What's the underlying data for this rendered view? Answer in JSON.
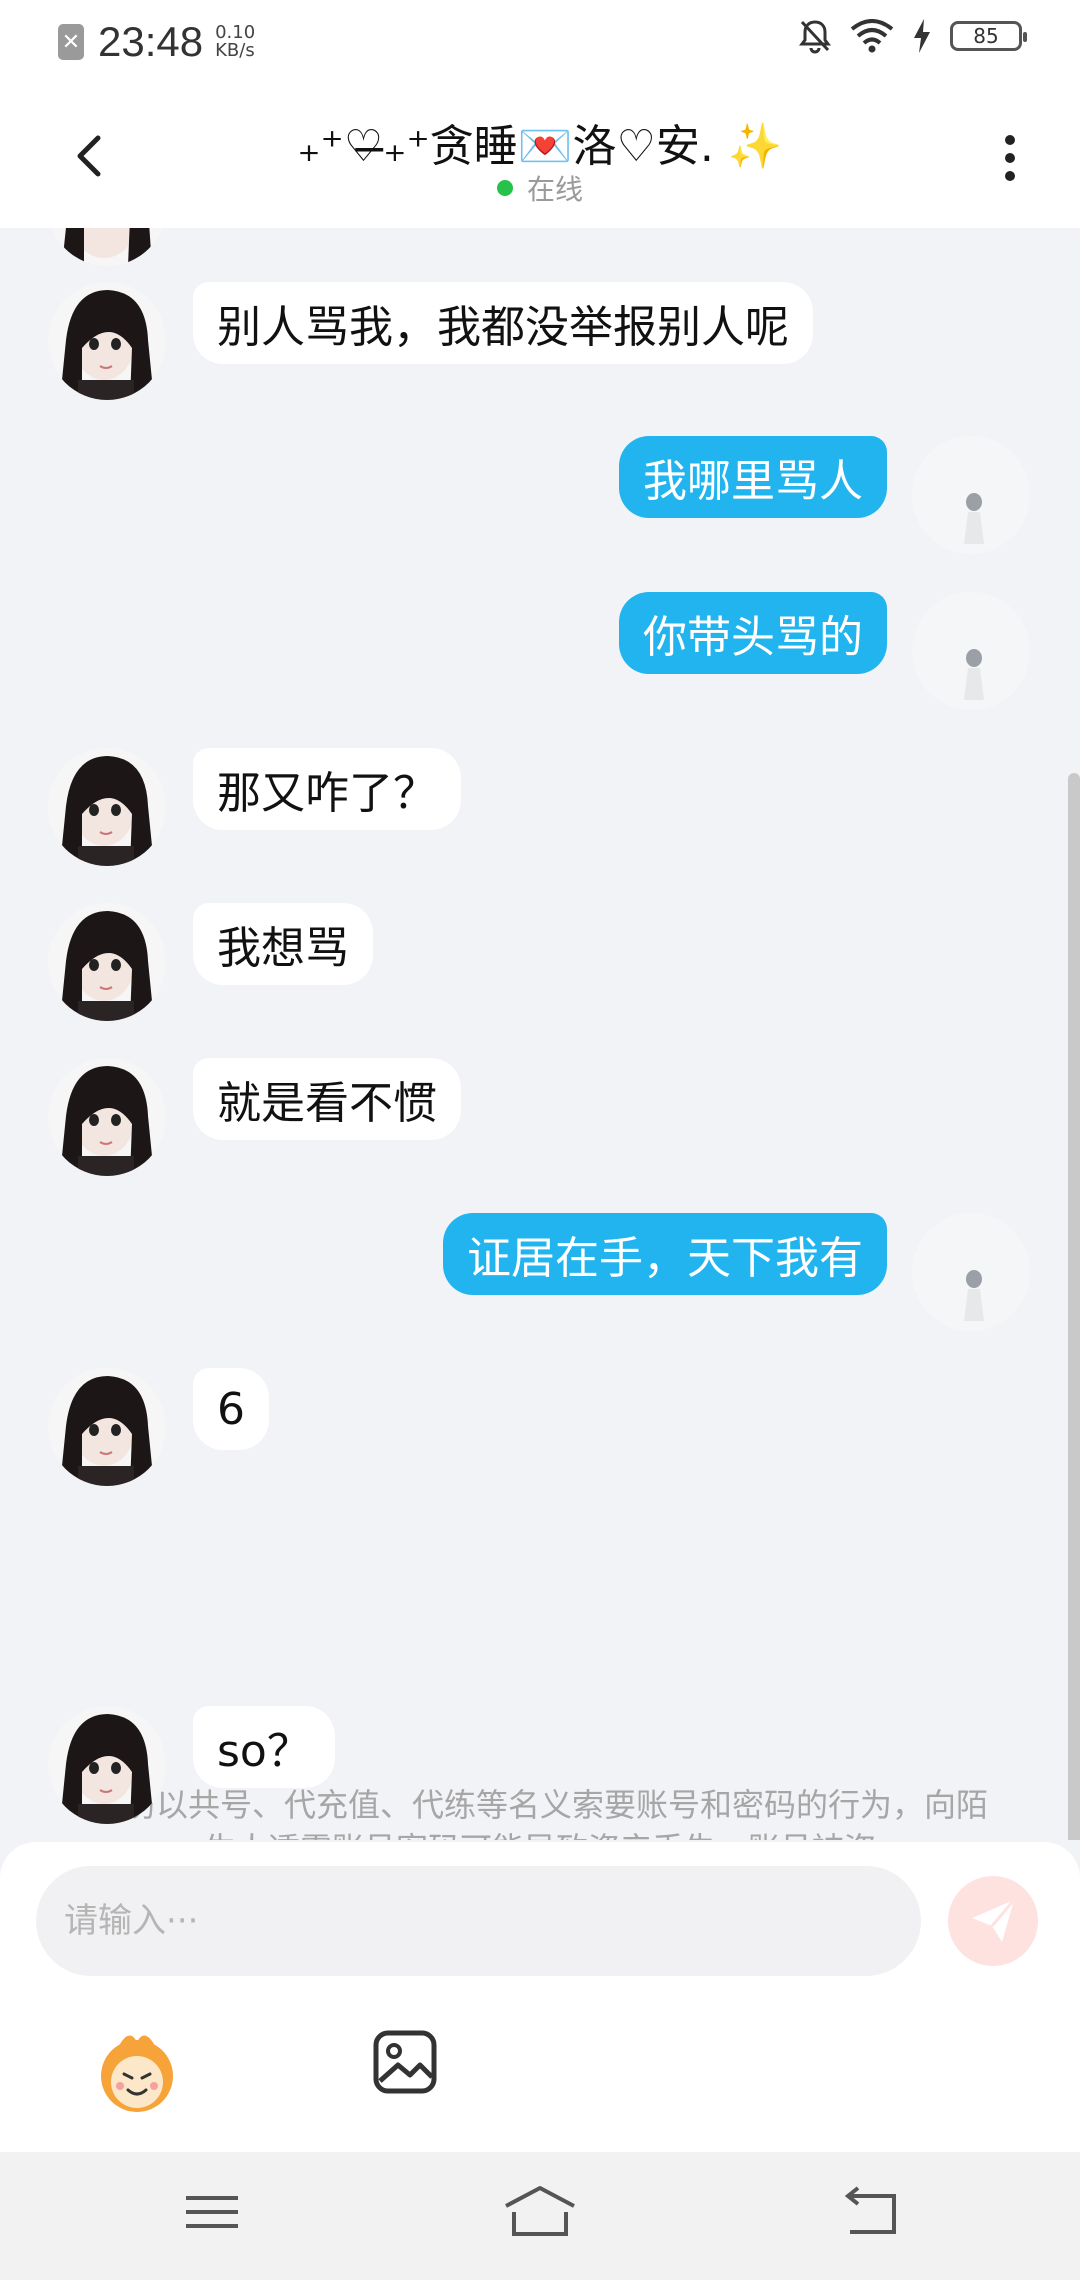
{
  "status_bar": {
    "time": "23:48",
    "net_speed_value": "0.10",
    "net_speed_unit": "KB/s",
    "battery": "85",
    "icons": [
      "sim-blocked-icon",
      "mute-bell-icon",
      "wifi-icon",
      "charging-icon",
      "battery-icon"
    ]
  },
  "header": {
    "title": "₊⁺♡̶₊⁺贪睡💌洛♡安. ✨",
    "status": "在线"
  },
  "messages": [
    {
      "dir": "in",
      "text": "别人骂我，我都没举报别人呢"
    },
    {
      "dir": "out",
      "text": "我哪里骂人"
    },
    {
      "dir": "out",
      "text": "你带头骂的"
    },
    {
      "dir": "in",
      "text": "那又咋了？"
    },
    {
      "dir": "in",
      "text": "我想骂"
    },
    {
      "dir": "in",
      "text": "就是看不惯"
    },
    {
      "dir": "out",
      "text": "证居在手，天下我有"
    },
    {
      "dir": "in",
      "text": "6"
    },
    {
      "dir": "in",
      "text": "so？"
    }
  ],
  "notice": "谨防以共号、代充值、代练等名义索要账号和密码的行为，向陌生人透露账号密码可能导致资产丢失，账号被盗",
  "input": {
    "placeholder": "请输入···"
  },
  "colors": {
    "outgoing_bubble": "#22b4ee",
    "incoming_bubble": "#ffffff",
    "background": "#f2f3f7",
    "online_dot": "#26c24a",
    "send_button": "#fde2e0"
  }
}
